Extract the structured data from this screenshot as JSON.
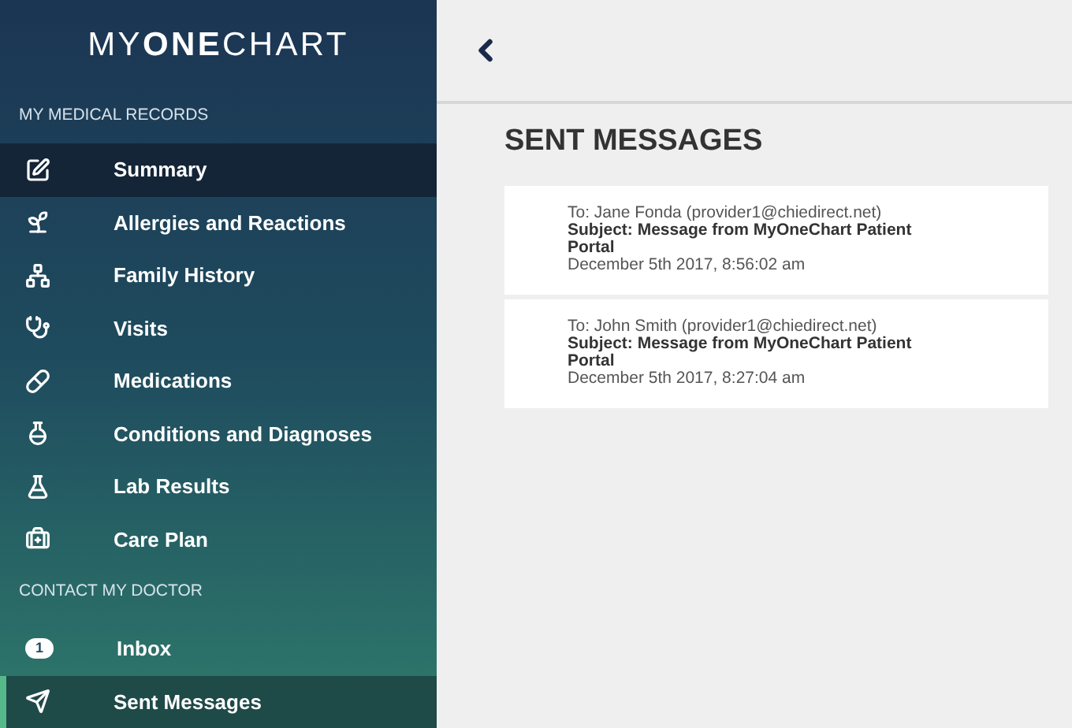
{
  "logo": "MY**ONE**CHART",
  "sidebar": {
    "sections": [
      {
        "heading": "MY MEDICAL RECORDS",
        "items": [
          {
            "label": "Summary",
            "selected": false,
            "highlighted": true
          },
          {
            "label": "Allergies and Reactions",
            "selected": false,
            "highlighted": false
          },
          {
            "label": "Family History",
            "selected": false,
            "highlighted": false
          },
          {
            "label": "Visits",
            "selected": false,
            "highlighted": false
          },
          {
            "label": "Medications",
            "selected": false,
            "highlighted": false
          },
          {
            "label": "Conditions and Diagnoses",
            "selected": false,
            "highlighted": false
          },
          {
            "label": "Lab Results",
            "selected": false,
            "highlighted": false
          },
          {
            "label": "Care Plan",
            "selected": false,
            "highlighted": false
          }
        ]
      },
      {
        "heading": "CONTACT MY DOCTOR",
        "items": [
          {
            "label": "Inbox",
            "badge": "1",
            "selected": false,
            "highlighted": false
          },
          {
            "label": "Sent Messages",
            "selected": true,
            "highlighted": false
          }
        ]
      }
    ]
  },
  "main": {
    "title": "SENT MESSAGES",
    "messages": [
      {
        "to": "To: Jane Fonda (provider1@chiedirect.net)",
        "subject": "Subject: Message from MyOneChart Patient Portal",
        "date": "December 5th 2017, 8:56:02 am"
      },
      {
        "to": "To: John Smith (provider1@chiedirect.net)",
        "subject": "Subject: Message from MyOneChart Patient Portal",
        "date": "December 5th 2017, 8:27:04 am"
      }
    ]
  }
}
